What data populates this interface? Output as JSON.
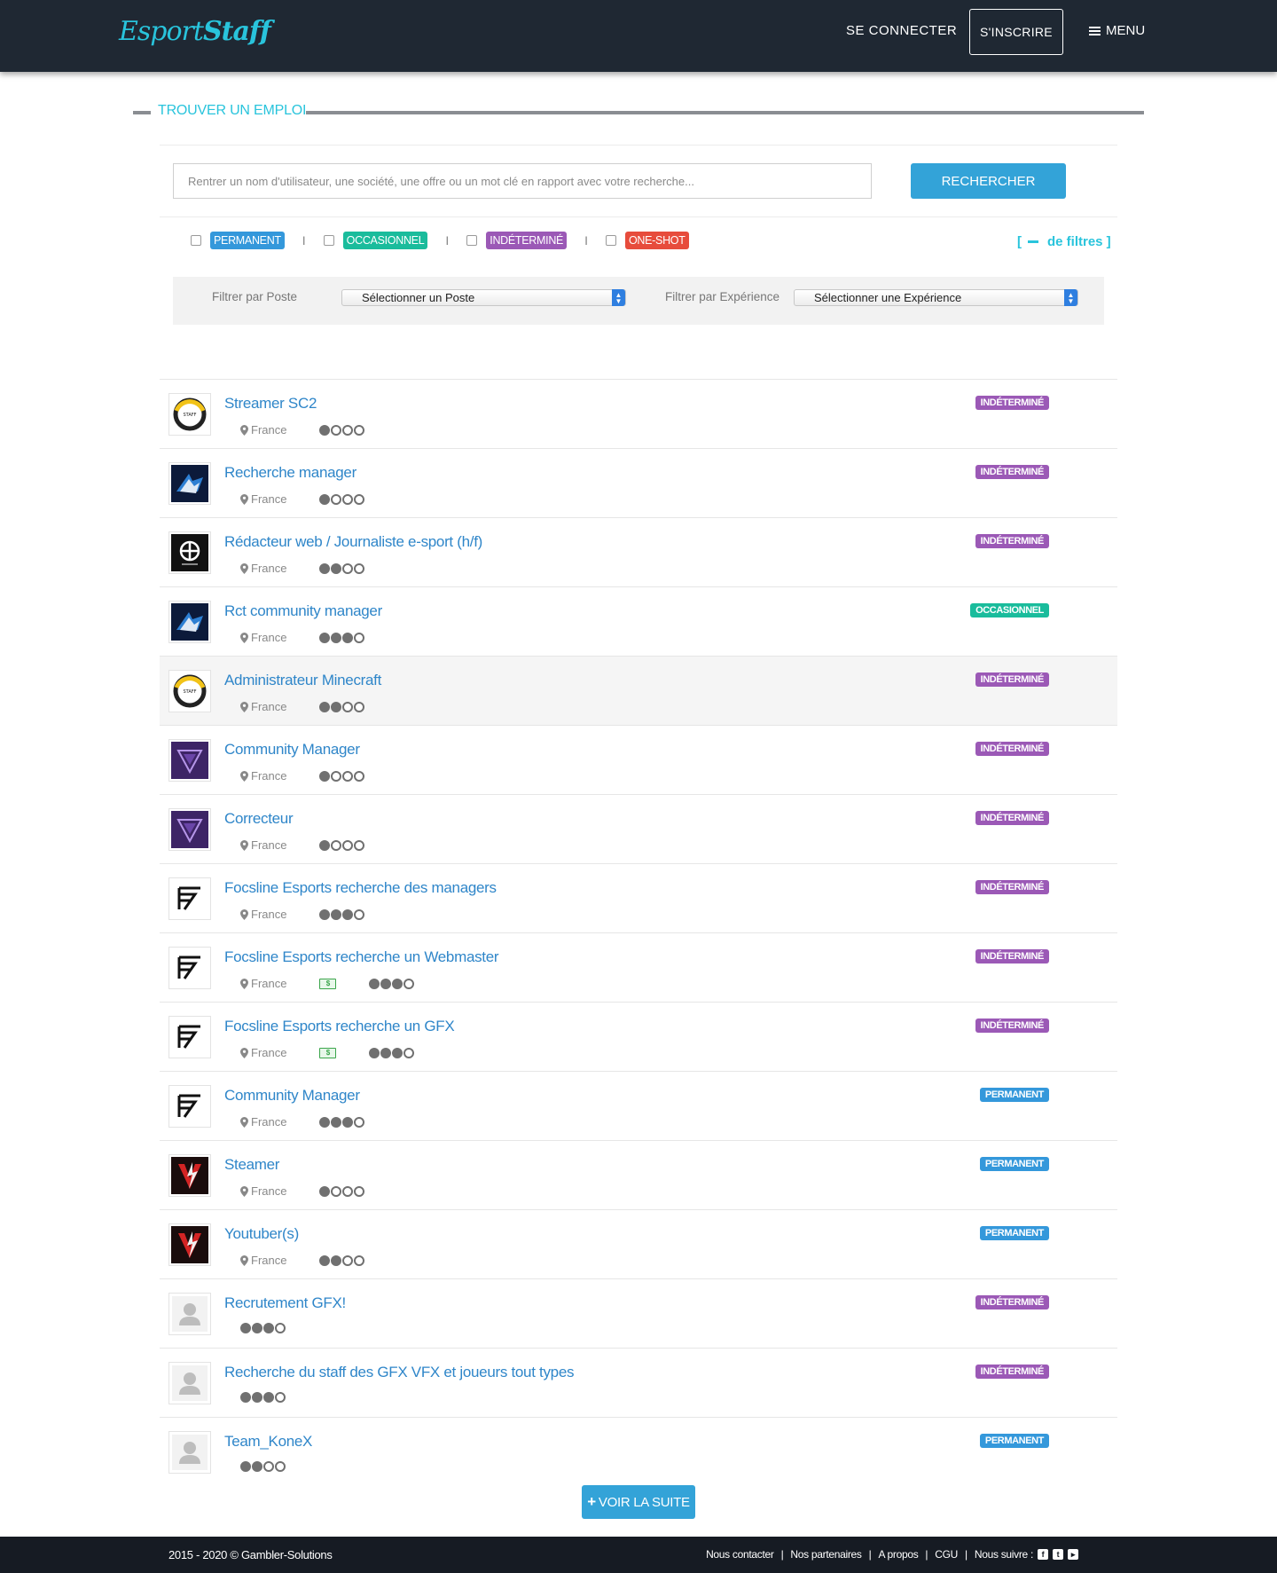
{
  "header": {
    "logo_a": "Esport",
    "logo_b": "Staff",
    "login": "SE CONNECTER",
    "signup": "S'INSCRIRE",
    "menu": "MENU"
  },
  "section": {
    "title": "TROUVER UN EMPLOI"
  },
  "search": {
    "placeholder": "Rentrer un nom d'utilisateur, une société, une offre ou un mot clé en rapport avec votre recherche...",
    "button": "RECHERCHER"
  },
  "types": [
    {
      "label": "PERMANENT",
      "color": "#3498db"
    },
    {
      "label": "OCCASIONNEL",
      "color": "#1abc9c"
    },
    {
      "label": "INDÉTERMINÉ",
      "color": "#9b59b6"
    },
    {
      "label": "ONE-SHOT",
      "color": "#e74c3c"
    }
  ],
  "filters": {
    "toggle_open": "[",
    "toggle_text": "de filtres ]",
    "poste_label": "Filtrer par Poste",
    "poste_value": "Sélectionner un Poste",
    "exp_label": "Filtrer par Expérience",
    "exp_value": "Sélectionner une Expérience"
  },
  "colors": {
    "INDÉTERMINÉ": "#9b59b6",
    "OCCASIONNEL": "#1abc9c",
    "PERMANENT": "#3498db"
  },
  "jobs": [
    {
      "title": "Streamer SC2",
      "location": "France",
      "level": 1,
      "type": "INDÉTERMINÉ",
      "logo": "ring",
      "paid": false
    },
    {
      "title": "Recherche manager",
      "location": "France",
      "level": 1,
      "type": "INDÉTERMINÉ",
      "logo": "shark",
      "paid": false
    },
    {
      "title": "Rédacteur web / Journaliste e-sport (h/f)",
      "location": "France",
      "level": 2,
      "type": "INDÉTERMINÉ",
      "logo": "emblem",
      "paid": false
    },
    {
      "title": "Rct community manager",
      "location": "France",
      "level": 3,
      "type": "OCCASIONNEL",
      "logo": "shark",
      "paid": false
    },
    {
      "title": "Administrateur Minecraft",
      "location": "France",
      "level": 2,
      "type": "INDÉTERMINÉ",
      "logo": "ring",
      "paid": false,
      "highlight": true
    },
    {
      "title": "Community Manager",
      "location": "France",
      "level": 1,
      "type": "INDÉTERMINÉ",
      "logo": "purple",
      "paid": false
    },
    {
      "title": "Correcteur",
      "location": "France",
      "level": 1,
      "type": "INDÉTERMINÉ",
      "logo": "purple",
      "paid": false
    },
    {
      "title": "Focsline Esports recherche des managers",
      "location": "France",
      "level": 3,
      "type": "INDÉTERMINÉ",
      "logo": "focs",
      "paid": false
    },
    {
      "title": "Focsline Esports recherche un Webmaster",
      "location": "France",
      "level": 3,
      "type": "INDÉTERMINÉ",
      "logo": "focs",
      "paid": true
    },
    {
      "title": "Focsline Esports recherche un GFX",
      "location": "France",
      "level": 3,
      "type": "INDÉTERMINÉ",
      "logo": "focs",
      "paid": true
    },
    {
      "title": "Community Manager",
      "location": "France",
      "level": 3,
      "type": "PERMANENT",
      "logo": "focs",
      "paid": false
    },
    {
      "title": "Steamer",
      "location": "France",
      "level": 1,
      "type": "PERMANENT",
      "logo": "v",
      "paid": false
    },
    {
      "title": "Youtuber(s)",
      "location": "France",
      "level": 2,
      "type": "PERMANENT",
      "logo": "v",
      "paid": false
    },
    {
      "title": "Recrutement GFX!",
      "location": "",
      "level": 3,
      "type": "INDÉTERMINÉ",
      "logo": "user",
      "paid": false
    },
    {
      "title": "Recherche du staff des GFX VFX et joueurs tout types",
      "location": "",
      "level": 3,
      "type": "INDÉTERMINÉ",
      "logo": "user",
      "paid": false
    },
    {
      "title": "Team_KoneX",
      "location": "",
      "level": 2,
      "type": "PERMANENT",
      "logo": "user",
      "paid": false
    }
  ],
  "more_button": "VOIR LA SUITE",
  "footer": {
    "copyright": "2015 - 2020 © Gambler-Solutions",
    "links": [
      "Nous contacter",
      "Nos partenaires",
      "A propos",
      "CGU",
      "Nous suivre :"
    ],
    "social": [
      "facebook-icon",
      "twitter-icon",
      "youtube-icon"
    ]
  }
}
